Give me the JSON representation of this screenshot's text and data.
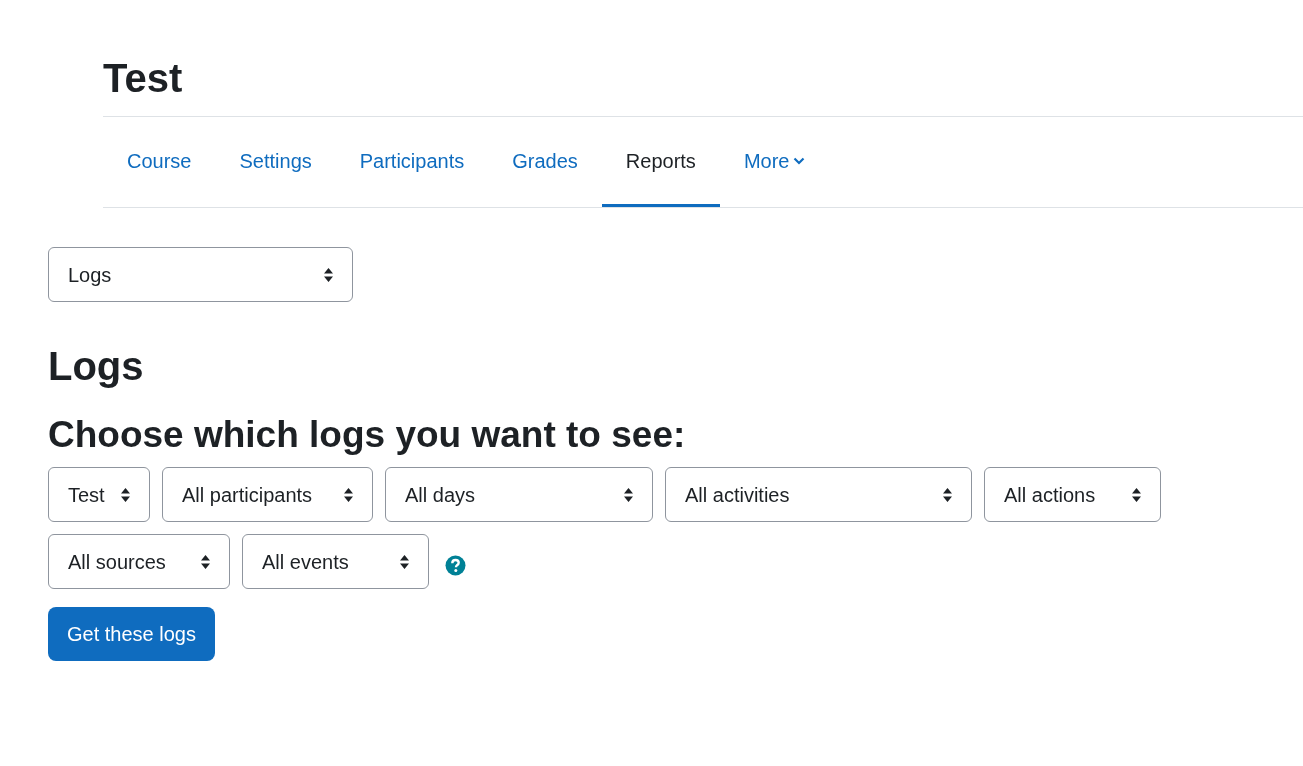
{
  "course_title": "Test",
  "tabs": [
    {
      "label": "Course",
      "selected": false,
      "dropdown": false
    },
    {
      "label": "Settings",
      "selected": false,
      "dropdown": false
    },
    {
      "label": "Participants",
      "selected": false,
      "dropdown": false
    },
    {
      "label": "Grades",
      "selected": false,
      "dropdown": false
    },
    {
      "label": "Reports",
      "selected": true,
      "dropdown": false
    },
    {
      "label": "More",
      "selected": false,
      "dropdown": true
    }
  ],
  "report_select": {
    "value": "Logs"
  },
  "page_heading": "Logs",
  "form_heading": "Choose which logs you want to see:",
  "filter_rows": [
    [
      {
        "value": "Test"
      },
      {
        "value": "All participants"
      },
      {
        "value": "All days"
      },
      {
        "value": "All activities"
      },
      {
        "value": "All actions"
      }
    ],
    [
      {
        "value": "All sources"
      },
      {
        "value": "All events"
      }
    ]
  ],
  "submit_button": "Get these logs"
}
